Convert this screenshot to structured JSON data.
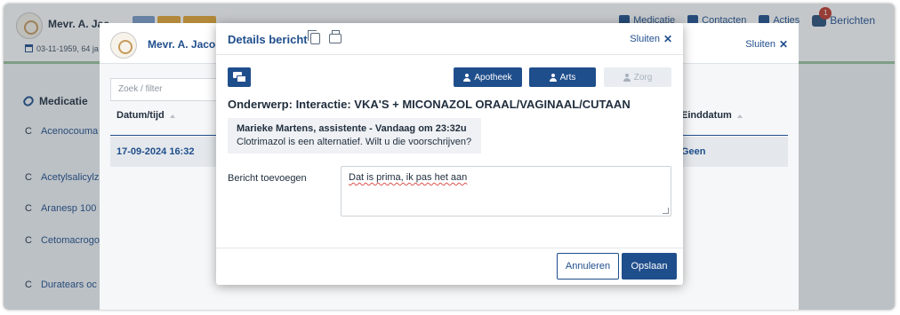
{
  "app": {
    "patient_name": "Mevr. A. Jac",
    "tags": [
      "",
      "",
      ""
    ],
    "patient_sub": "03-11-1959, 64 ja",
    "nav": [
      "Medicatie",
      "Contacten",
      "Acties"
    ],
    "messages_label": "Berichten",
    "messages_count": "1"
  },
  "med_panel": {
    "tab_label": "Medicatie",
    "rows": [
      {
        "prefix": "C",
        "name": "Acenocouma"
      },
      {
        "prefix": "C",
        "name": "Acetylsalicylz"
      },
      {
        "prefix": "C",
        "name": "Aranesp 100"
      },
      {
        "prefix": "C",
        "name": "Cetomacrogo"
      },
      {
        "prefix": "C",
        "name": "Duratears oc"
      }
    ]
  },
  "mid_modal": {
    "patient_name": "Mevr. A. Jaco",
    "close_label": "Sluiten",
    "filter_placeholder": "Zoek / filter",
    "col_date": "Datum/tijd",
    "col_end": "Einddatum",
    "selected_date": "17-09-2024 16:32",
    "selected_end": "Geen"
  },
  "detail": {
    "title": "Details bericht",
    "close_label": "Sluiten",
    "buttons": {
      "apotheek": "Apotheek",
      "arts": "Arts",
      "zorg": "Zorg"
    },
    "subject": "Onderwerp: Interactie: VKA'S + MICONAZOL ORAAL/VAGINAAL/CUTAAN",
    "message": {
      "author": "Marieke Martens, assistente - Vandaag om 23:32u",
      "text": "Clotrimazol is een alternatief. Wilt u die voorschrijven?"
    },
    "add_label": "Bericht toevoegen",
    "add_value": "Dat is prima, ik pas het aan",
    "cancel_label": "Annuleren",
    "save_label": "Opslaan"
  },
  "colors": {
    "primary": "#1f4e8c",
    "disabled": "#e9edf1",
    "accent_green": "#9bc59d",
    "badge_red": "#c0392b"
  }
}
